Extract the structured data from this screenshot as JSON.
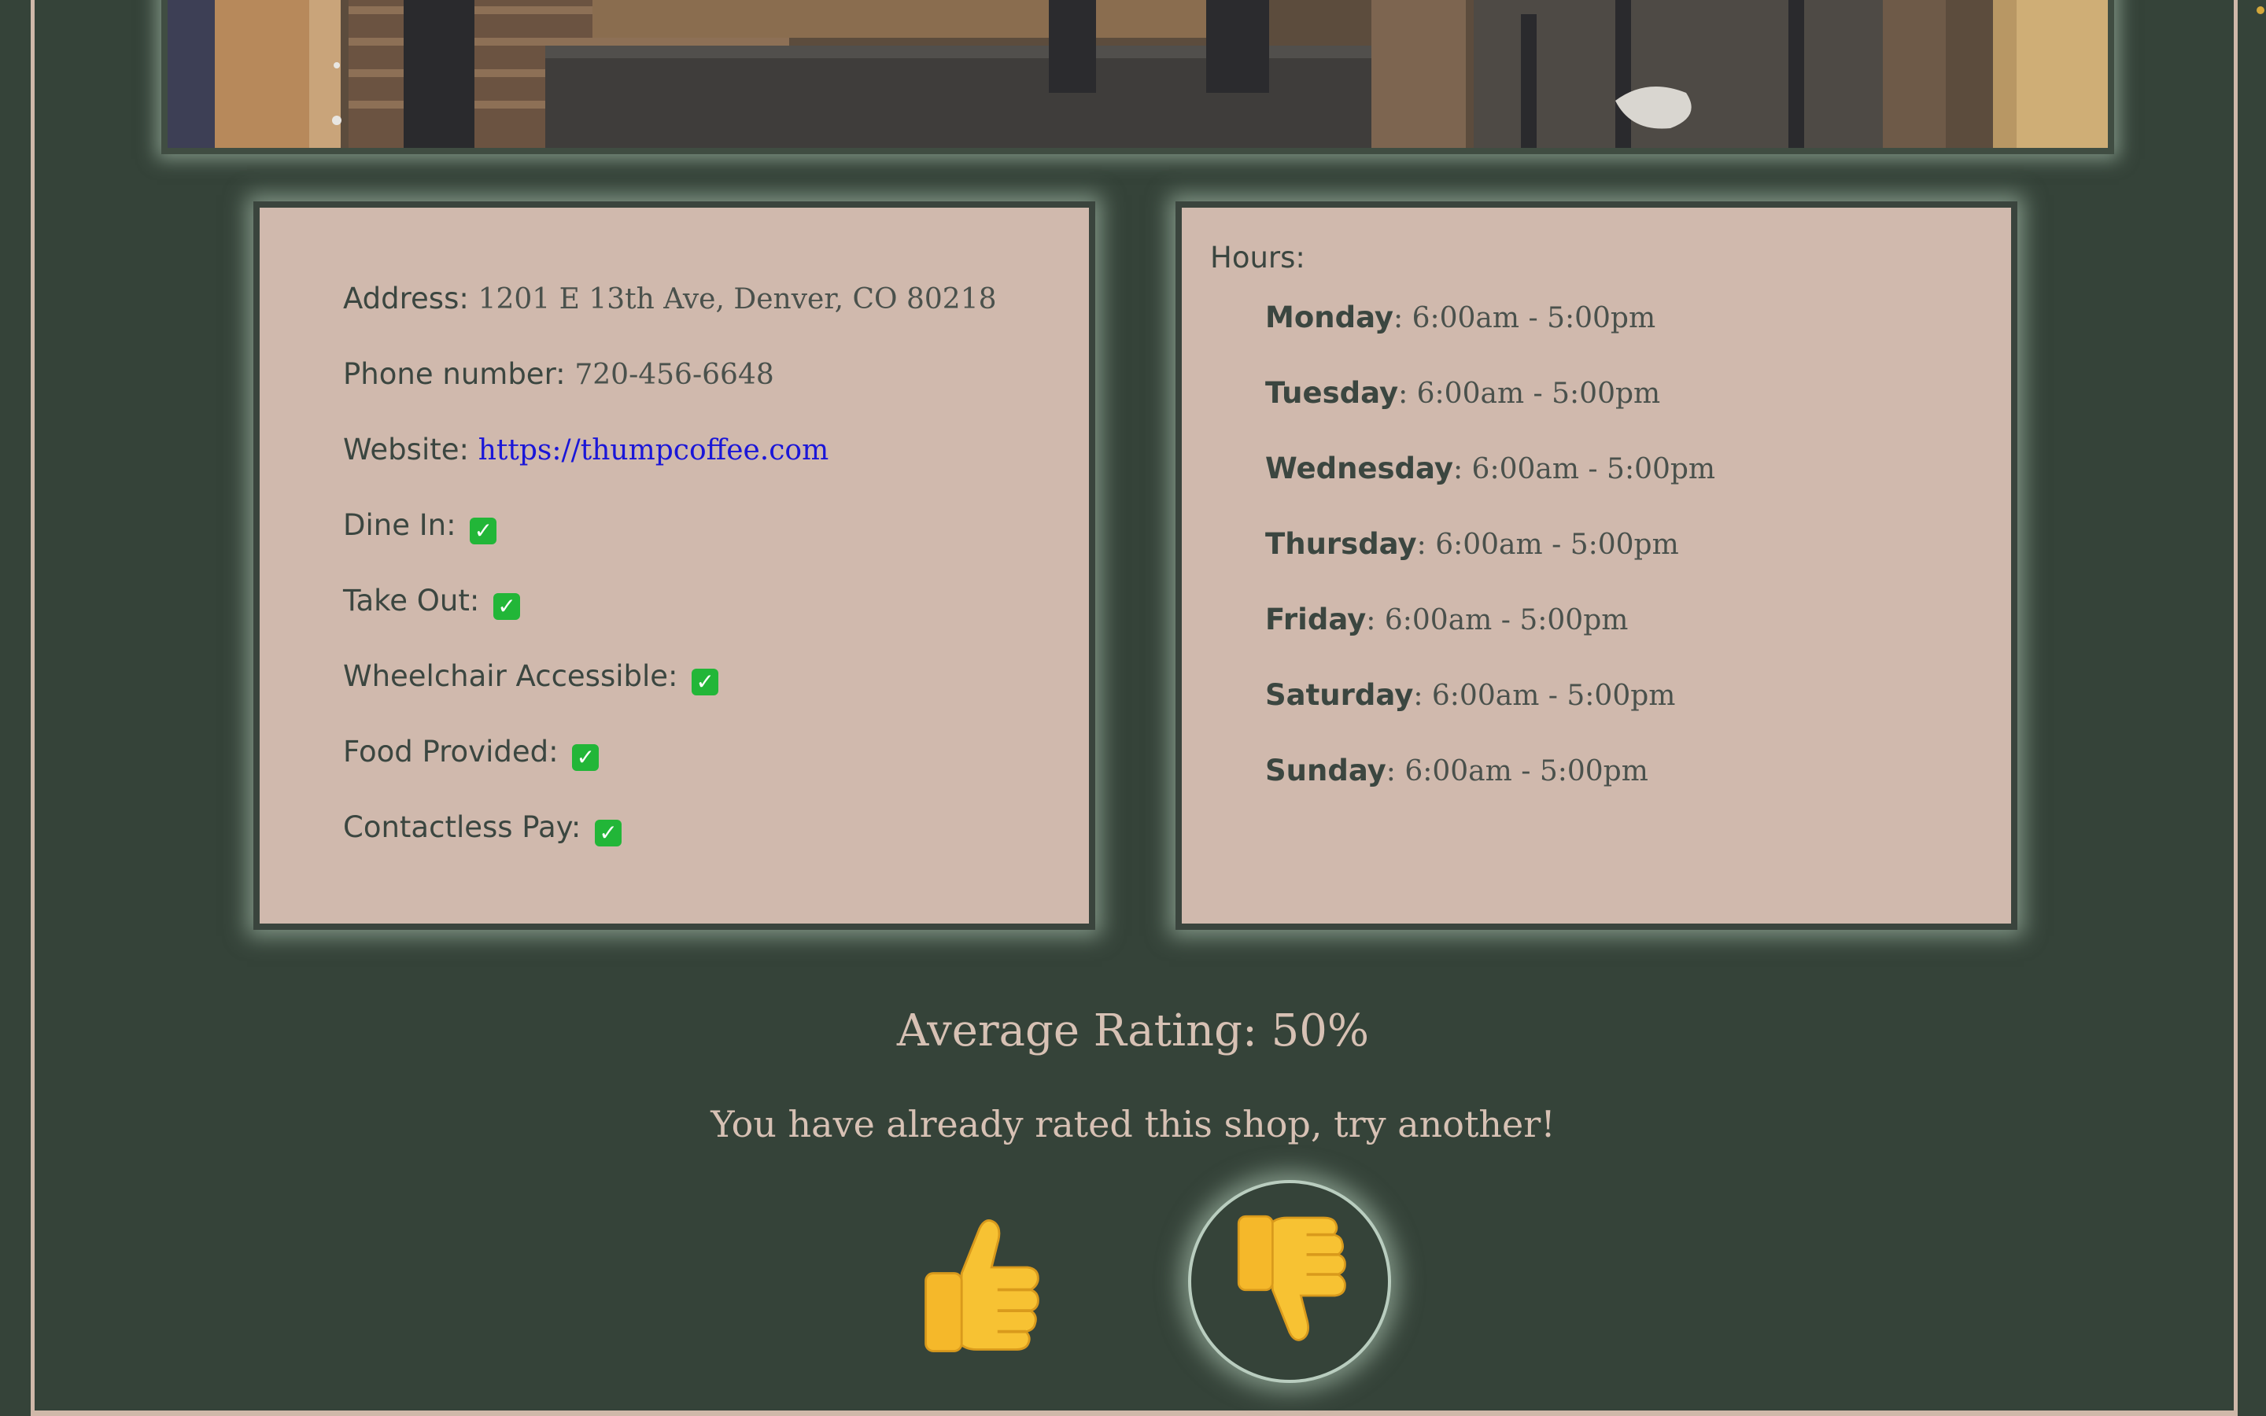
{
  "info": {
    "address_label": "Address:",
    "address_value": "1201 E 13th Ave, Denver, CO 80218",
    "phone_label": "Phone number:",
    "phone_value": "720-456-6648",
    "website_label": "Website:",
    "website_value": "https://thumpcoffee.com",
    "dine_in_label": "Dine In:",
    "take_out_label": "Take Out:",
    "wheelchair_label": "Wheelchair Accessible:",
    "food_label": "Food Provided:",
    "contactless_label": "Contactless Pay:",
    "check_symbol": "✓"
  },
  "hours": {
    "title": "Hours:",
    "days": [
      {
        "day": "Monday",
        "time": ": 6:00am - 5:00pm"
      },
      {
        "day": "Tuesday",
        "time": ": 6:00am - 5:00pm"
      },
      {
        "day": "Wednesday",
        "time": ": 6:00am - 5:00pm"
      },
      {
        "day": "Thursday",
        "time": ": 6:00am - 5:00pm"
      },
      {
        "day": "Friday",
        "time": ": 6:00am - 5:00pm"
      },
      {
        "day": "Saturday",
        "time": ": 6:00am - 5:00pm"
      },
      {
        "day": "Sunday",
        "time": ": 6:00am - 5:00pm"
      }
    ]
  },
  "rating": {
    "average": "Average Rating: 50%",
    "message": "You have already rated this shop, try another!"
  },
  "icons": {
    "thumbs_up": "thumbs-up-icon",
    "thumbs_down": "thumbs-down-icon",
    "check": "check-mark-icon"
  },
  "colors": {
    "background": "#354339",
    "card": "#d0b9ad",
    "link": "#1a16d8",
    "check": "#22b638",
    "thumb": "#f7c233"
  }
}
